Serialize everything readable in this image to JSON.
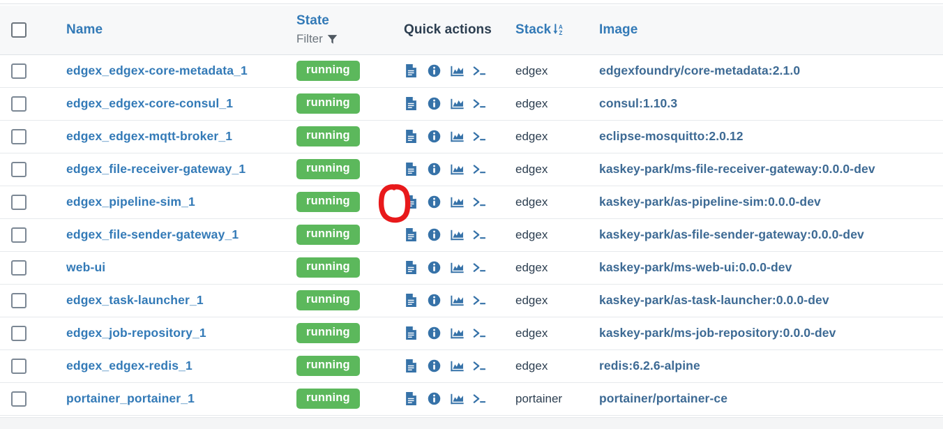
{
  "table": {
    "columns": [
      {
        "key": "select",
        "label": "",
        "type": "checkbox"
      },
      {
        "key": "name",
        "label": "Name",
        "sortable": true
      },
      {
        "key": "state",
        "label": "State",
        "sublabel": "Filter",
        "filter_icon": "funnel-icon",
        "sortable": true
      },
      {
        "key": "quick",
        "label": "Quick actions",
        "sortable": false
      },
      {
        "key": "stack",
        "label": "Stack",
        "sort_icon": "sort-alpha-asc-icon",
        "sorted": true,
        "sort_direction": "asc"
      },
      {
        "key": "image",
        "label": "Image",
        "sortable": true
      }
    ],
    "quick_action_icons": [
      {
        "name": "logs-icon",
        "title": "Logs"
      },
      {
        "name": "inspect-icon",
        "title": "Inspect"
      },
      {
        "name": "stats-icon",
        "title": "Stats"
      },
      {
        "name": "console-icon",
        "title": "Console"
      }
    ],
    "rows": [
      {
        "name": "edgex_edgex-core-metadata_1",
        "state": "running",
        "stack": "edgex",
        "image": "edgexfoundry/core-metadata:2.1.0",
        "selected": false,
        "highlighted": false
      },
      {
        "name": "edgex_edgex-core-consul_1",
        "state": "running",
        "stack": "edgex",
        "image": "consul:1.10.3",
        "selected": false,
        "highlighted": false
      },
      {
        "name": "edgex_edgex-mqtt-broker_1",
        "state": "running",
        "stack": "edgex",
        "image": "eclipse-mosquitto:2.0.12",
        "selected": false,
        "highlighted": false
      },
      {
        "name": "edgex_file-receiver-gateway_1",
        "state": "running",
        "stack": "edgex",
        "image": "kaskey-park/ms-file-receiver-gateway:0.0.0-dev",
        "selected": false,
        "highlighted": false
      },
      {
        "name": "edgex_pipeline-sim_1",
        "state": "running",
        "stack": "edgex",
        "image": "kaskey-park/as-pipeline-sim:0.0.0-dev",
        "selected": false,
        "highlighted": true
      },
      {
        "name": "edgex_file-sender-gateway_1",
        "state": "running",
        "stack": "edgex",
        "image": "kaskey-park/as-file-sender-gateway:0.0.0-dev",
        "selected": false,
        "highlighted": false
      },
      {
        "name": "web-ui",
        "state": "running",
        "stack": "edgex",
        "image": "kaskey-park/ms-web-ui:0.0.0-dev",
        "selected": false,
        "highlighted": false
      },
      {
        "name": "edgex_task-launcher_1",
        "state": "running",
        "stack": "edgex",
        "image": "kaskey-park/as-task-launcher:0.0.0-dev",
        "selected": false,
        "highlighted": false
      },
      {
        "name": "edgex_job-repository_1",
        "state": "running",
        "stack": "edgex",
        "image": "kaskey-park/ms-job-repository:0.0.0-dev",
        "selected": false,
        "highlighted": false
      },
      {
        "name": "edgex_edgex-redis_1",
        "state": "running",
        "stack": "edgex",
        "image": "redis:6.2.6-alpine",
        "selected": false,
        "highlighted": false
      },
      {
        "name": "portainer_portainer_1",
        "state": "running",
        "stack": "portainer",
        "image": "portainer/portainer-ce",
        "selected": false,
        "highlighted": false
      }
    ]
  },
  "annotation": {
    "shape": "hand-drawn-oval",
    "target": "logs-icon of row edgex_pipeline-sim_1",
    "color": "#e8191b"
  },
  "colors": {
    "link": "#337ab7",
    "image_link": "#3d6a94",
    "running_badge": "#5cb85c",
    "header_bg": "#f7f8f9",
    "row_border": "#e6e9ec",
    "text": "#2c3e50",
    "muted": "#6c757d",
    "annotation_red": "#e8191b"
  }
}
